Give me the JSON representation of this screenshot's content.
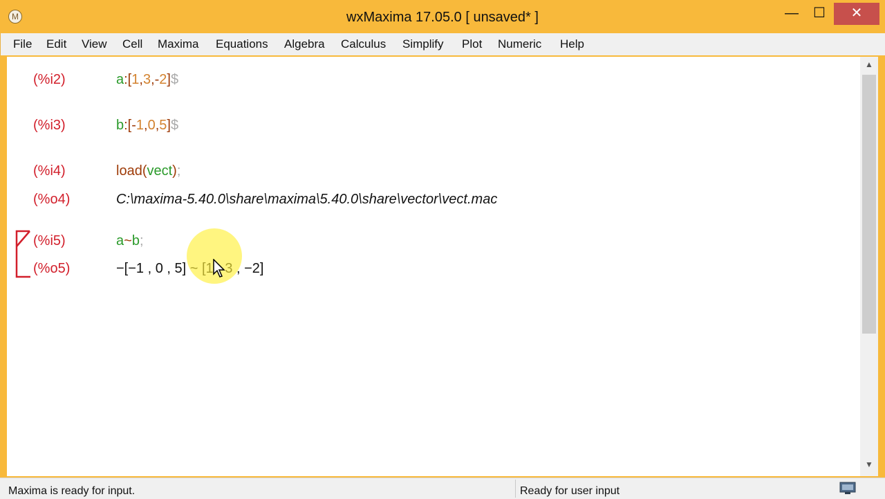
{
  "window": {
    "title": "wxMaxima 17.05.0 [ unsaved* ]",
    "app_icon_glyph": "M"
  },
  "window_controls": {
    "minimize": "—",
    "maximize": "☐",
    "close": "✕"
  },
  "menu": [
    "File",
    "Edit",
    "View",
    "Cell",
    "Maxima",
    "Equations",
    "Algebra",
    "Calculus",
    "Simplify",
    "Plot",
    "Numeric",
    "Help"
  ],
  "cells": {
    "i2": {
      "label": "(%i2)",
      "tokens": [
        "a",
        ":[",
        "1",
        ",",
        "3",
        ",-",
        "2",
        "]",
        "$"
      ]
    },
    "i3": {
      "label": "(%i3)",
      "tokens": [
        "b",
        ":[-",
        "1",
        ",",
        "0",
        ",",
        "5",
        "]",
        "$"
      ]
    },
    "i4": {
      "label": "(%i4)",
      "tokens": [
        "load",
        "(",
        "vect",
        ")",
        ";"
      ]
    },
    "o4": {
      "label": "(%o4)",
      "text": "C:\\maxima-5.40.0\\share\\maxima\\5.40.0\\share\\vector\\vect.mac"
    },
    "i5": {
      "label": "(%i5)",
      "tokens": [
        "a",
        "~",
        "b",
        ";"
      ]
    },
    "o5": {
      "label": "(%o5)",
      "text": "−[−1 , 0 , 5] ~ [1 , 3 , −2]"
    }
  },
  "status": {
    "left": "Maxima is ready for input.",
    "right": "Ready for user input"
  },
  "colors": {
    "title_bar": "#f8b93b",
    "label_red": "#d21f2b",
    "var_green": "#2a9a2a",
    "number_orange": "#d3822e",
    "close_red": "#c7504c"
  },
  "icons": [
    "app-icon",
    "cursor-icon",
    "network-icon",
    "scroll-up-icon",
    "scroll-down-icon"
  ]
}
